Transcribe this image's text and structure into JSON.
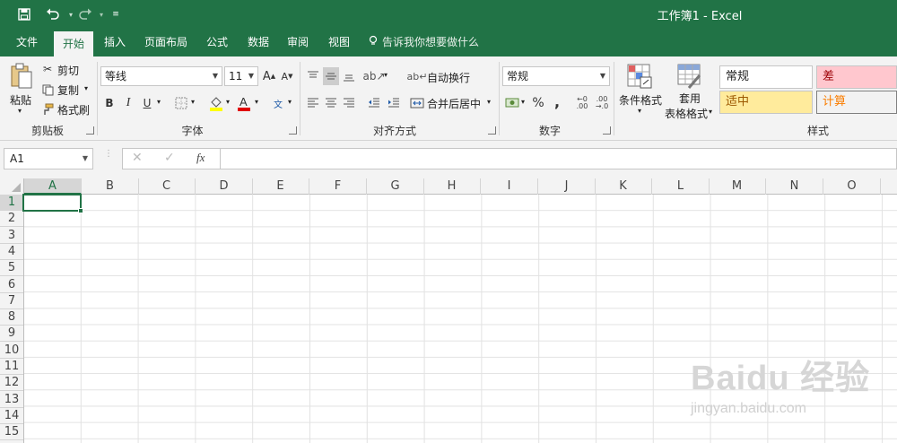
{
  "window": {
    "title": "工作簿1  -  Excel"
  },
  "tabs": [
    {
      "label": "文件"
    },
    {
      "label": "开始"
    },
    {
      "label": "插入"
    },
    {
      "label": "页面布局"
    },
    {
      "label": "公式"
    },
    {
      "label": "数据"
    },
    {
      "label": "审阅"
    },
    {
      "label": "视图"
    }
  ],
  "tellme": {
    "placeholder": "告诉我你想要做什么"
  },
  "clipboard": {
    "paste": "粘贴",
    "cut": "剪切",
    "copy": "复制",
    "format_painter": "格式刷",
    "group": "剪贴板"
  },
  "font": {
    "name": "等线",
    "size": "11",
    "group": "字体",
    "bold": "B",
    "italic": "I",
    "underline": "U"
  },
  "alignment": {
    "wrap": "自动换行",
    "merge": "合并后居中",
    "group": "对齐方式"
  },
  "number": {
    "format": "常规",
    "percent": "%",
    "comma": ",",
    "group": "数字"
  },
  "styles": {
    "conditional": "条件格式",
    "table_line1": "套用",
    "table_line2": "表格格式",
    "normal": "常规",
    "bad": "差",
    "neutral": "适中",
    "calc": "计算",
    "group": "样式"
  },
  "formula_bar": {
    "name_box": "A1",
    "fx": "fx"
  },
  "columns": [
    "A",
    "B",
    "C",
    "D",
    "E",
    "F",
    "G",
    "H",
    "I",
    "J",
    "K",
    "L",
    "M",
    "N",
    "O"
  ],
  "rows": [
    "1",
    "2",
    "3",
    "4",
    "5",
    "6",
    "7",
    "8",
    "9",
    "10",
    "11",
    "12",
    "13",
    "14",
    "15"
  ],
  "watermark": {
    "logo": "Baidu 经验",
    "url": "jingyan.baidu.com"
  },
  "colors": {
    "brand": "#217346",
    "bad_bg": "#ffc7ce",
    "bad_text": "#9c0006",
    "neutral_bg": "#ffeb9c",
    "neutral_text": "#9c5700",
    "calc_bg": "#f2f2f2",
    "calc_text": "#fa7d00"
  }
}
